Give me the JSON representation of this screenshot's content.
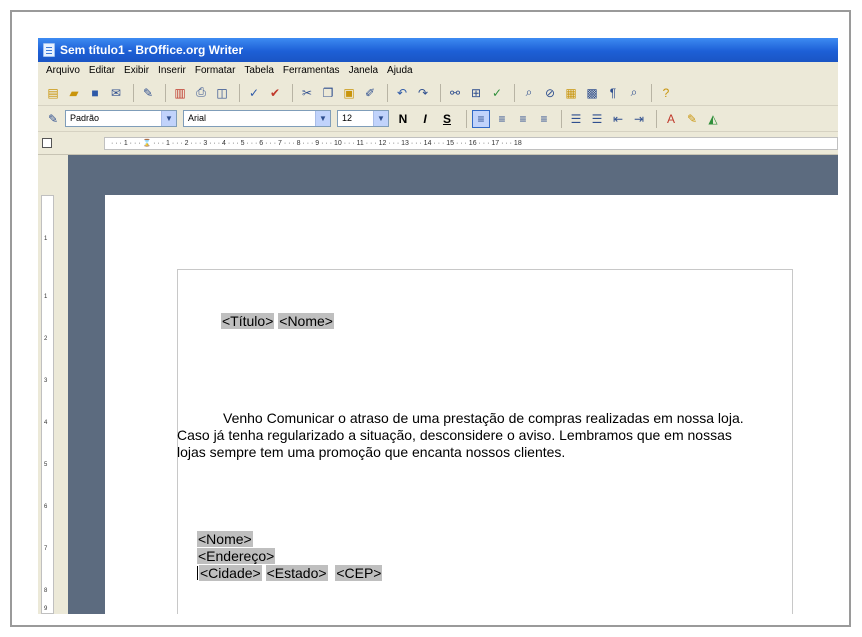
{
  "window": {
    "title": "Sem título1 - BrOffice.org Writer"
  },
  "menu": [
    "Arquivo",
    "Editar",
    "Exibir",
    "Inserir",
    "Formatar",
    "Tabela",
    "Ferramentas",
    "Janela",
    "Ajuda"
  ],
  "format_toolbar": {
    "style": "Padrão",
    "font": "Arial",
    "size": "12",
    "bold": "N",
    "italic": "I",
    "underline": "S"
  },
  "ruler": {
    "horizontal": "· · · 1 · · · ⌛ · · · 1 · · · 2 · · · 3 · · · 4 · · · 5 · · · 6 · · · 7 · · · 8 · · · 9 · · · 10 · · · 11 · · · 12 · · · 13 · · · 14 · · · 15 · · · 16 · · · 17 · · · 18",
    "vertical": [
      "1",
      "1",
      "2",
      "3",
      "4",
      "5",
      "6",
      "7",
      "8",
      "9"
    ]
  },
  "document": {
    "header_fields": [
      "<Título>",
      "<Nome>"
    ],
    "paragraph_lines": [
      "Venho Comunicar o atraso de uma prestação de compras realizadas em nossa loja.",
      "Caso já tenha regularizado a situação, desconsidere o aviso. Lembramos que em nossas",
      "lojas sempre tem uma promoção que encanta nossos clientes."
    ],
    "address": {
      "name": "<Nome>",
      "street": "<Endereço>",
      "city": "<Cidade>",
      "state": "<Estado>",
      "zip": "<CEP>"
    }
  }
}
